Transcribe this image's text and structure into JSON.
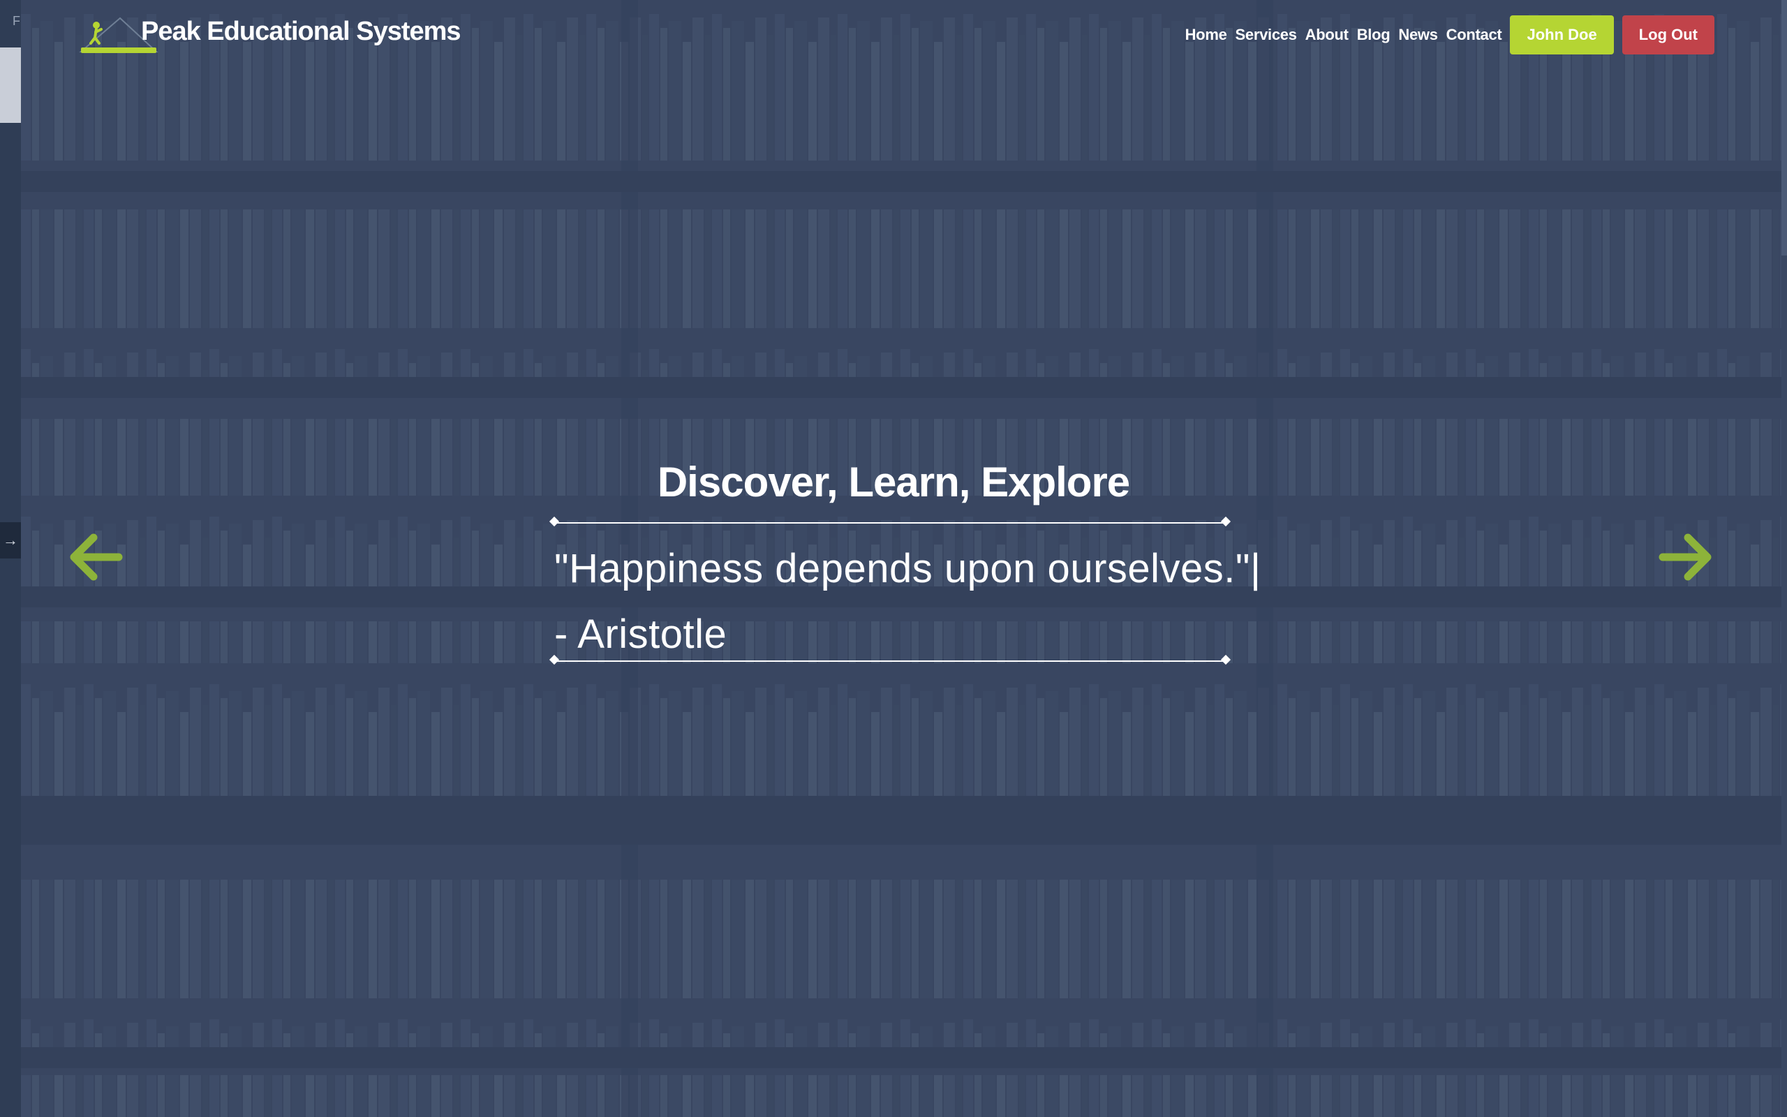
{
  "sidebar": {
    "top_letter": "F",
    "toggle_icon": "arrow-right-icon"
  },
  "header": {
    "logo_icon": "mountain-climber-logo",
    "brand": "Peak Educational Systems",
    "nav": [
      {
        "label": "Home"
      },
      {
        "label": "Services"
      },
      {
        "label": "About"
      },
      {
        "label": "Blog"
      },
      {
        "label": "News"
      },
      {
        "label": "Contact"
      }
    ],
    "user_button": "John Doe",
    "logout_button": "Log Out"
  },
  "hero": {
    "title": "Discover, Learn, Explore",
    "quote_line1": "\"Happiness depends upon ourselves.\"|",
    "quote_line2": "- Aristotle",
    "prev_icon": "arrow-left-icon",
    "next_icon": "arrow-right-icon"
  },
  "colors": {
    "accent_green": "#b5d533",
    "arrow_green": "#8db33a",
    "logout_red": "#c1434a",
    "overlay_blue": "#3b4a63"
  }
}
